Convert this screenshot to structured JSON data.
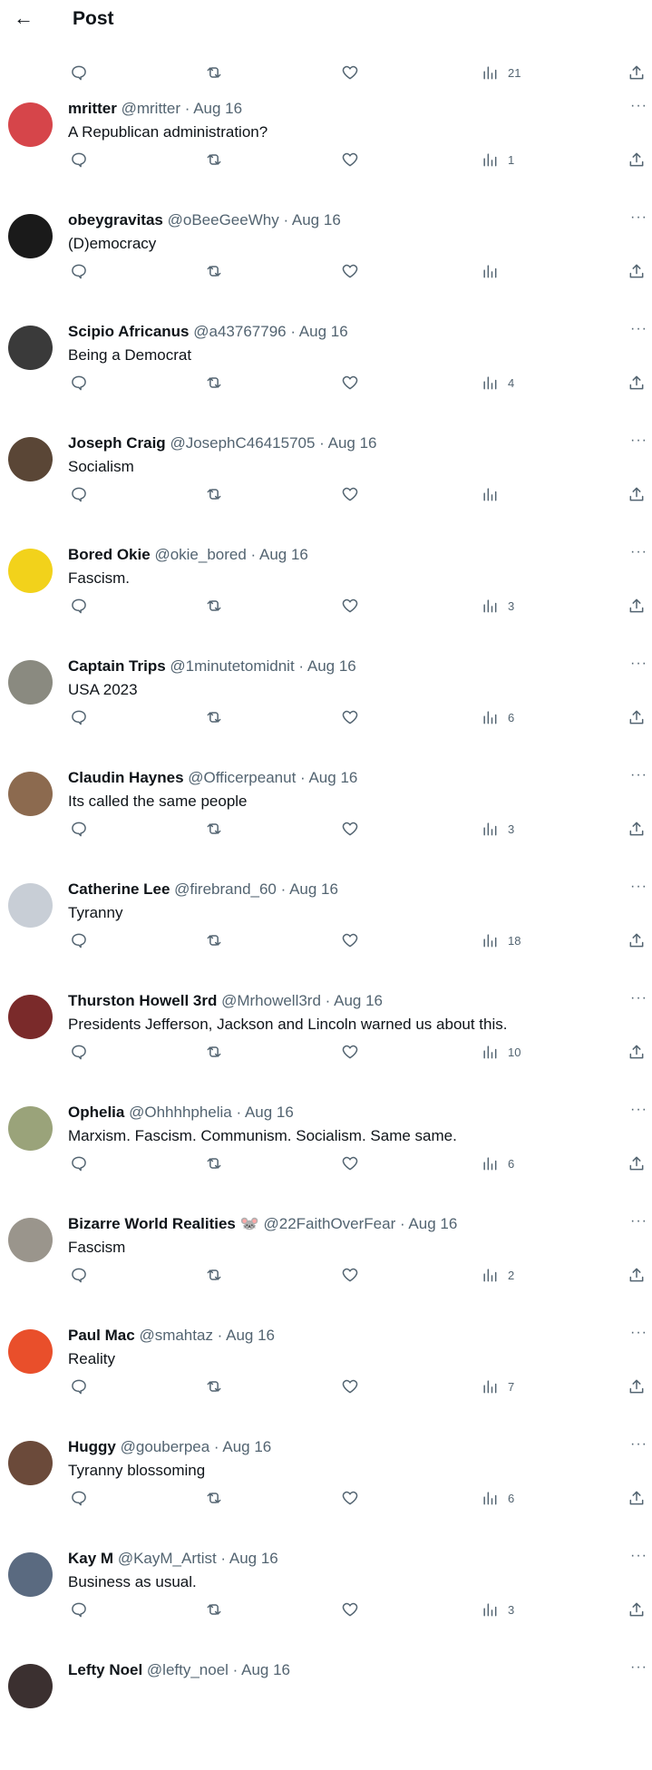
{
  "header": {
    "back_icon": "arrow-left-icon",
    "title": "Post"
  },
  "top_actions": {
    "views": "21"
  },
  "replies": [
    {
      "name": "mritter",
      "handle": "@mritter",
      "date": "Aug 16",
      "text": "A Republican administration?",
      "views": "1",
      "avatar_color": "#d6454a"
    },
    {
      "name": "obeygravitas",
      "handle": "@oBeeGeeWhy",
      "date": "Aug 16",
      "text": "(D)emocracy",
      "views": "",
      "avatar_color": "#1a1a1a"
    },
    {
      "name": "Scipio Africanus",
      "handle": "@a43767796",
      "date": "Aug 16",
      "text": "Being a Democrat",
      "views": "4",
      "avatar_color": "#3a3a3a"
    },
    {
      "name": "Joseph Craig",
      "handle": "@JosephC46415705",
      "date": "Aug 16",
      "text": "Socialism",
      "views": "",
      "avatar_color": "#5a4636"
    },
    {
      "name": "Bored Okie",
      "handle": "@okie_bored",
      "date": "Aug 16",
      "text": "Fascism.",
      "views": "3",
      "avatar_color": "#f2d21b"
    },
    {
      "name": "Captain Trips",
      "handle": "@1minutetomidnit",
      "date": "Aug 16",
      "text": "USA 2023",
      "views": "6",
      "avatar_color": "#8a8a80"
    },
    {
      "name": "Claudin Haynes",
      "handle": "@Officerpeanut",
      "date": "Aug 16",
      "text": "Its called the same people",
      "views": "3",
      "avatar_color": "#8c6a4f"
    },
    {
      "name": "Catherine Lee",
      "handle": "@firebrand_60",
      "date": "Aug 16",
      "text": "Tyranny",
      "views": "18",
      "avatar_color": "#c8ced6"
    },
    {
      "name": "Thurston Howell 3rd",
      "handle": "@Mrhowell3rd",
      "date": "Aug 16",
      "text": "Presidents Jefferson, Jackson and Lincoln warned us about this.",
      "views": "10",
      "avatar_color": "#7a2a2a"
    },
    {
      "name": "Ophelia",
      "handle": "@Ohhhhphelia",
      "date": "Aug 16",
      "text": "Marxism. Fascism.  Communism.  Socialism.   Same same.",
      "views": "6",
      "avatar_color": "#9aa37a"
    },
    {
      "name": "Bizarre World Realities 🐭",
      "handle": "@22FaithOverFear",
      "date": "Aug 16",
      "text": "Fascism",
      "views": "2",
      "avatar_color": "#9a958c"
    },
    {
      "name": "Paul Mac",
      "handle": "@smahtaz",
      "date": "Aug 16",
      "text": "Reality",
      "views": "7",
      "avatar_color": "#e94f2b"
    },
    {
      "name": "Huggy",
      "handle": "@gouberpea",
      "date": "Aug 16",
      "text": "Tyranny blossoming",
      "views": "6",
      "avatar_color": "#6b4a3a"
    },
    {
      "name": "Kay M",
      "handle": "@KayM_Artist",
      "date": "Aug 16",
      "text": "Business as usual.",
      "views": "3",
      "avatar_color": "#5a6a80"
    },
    {
      "name": "Lefty Noel",
      "handle": "@lefty_noel",
      "date": "Aug 16",
      "text": "",
      "views": "",
      "avatar_color": "#3b3030"
    }
  ]
}
